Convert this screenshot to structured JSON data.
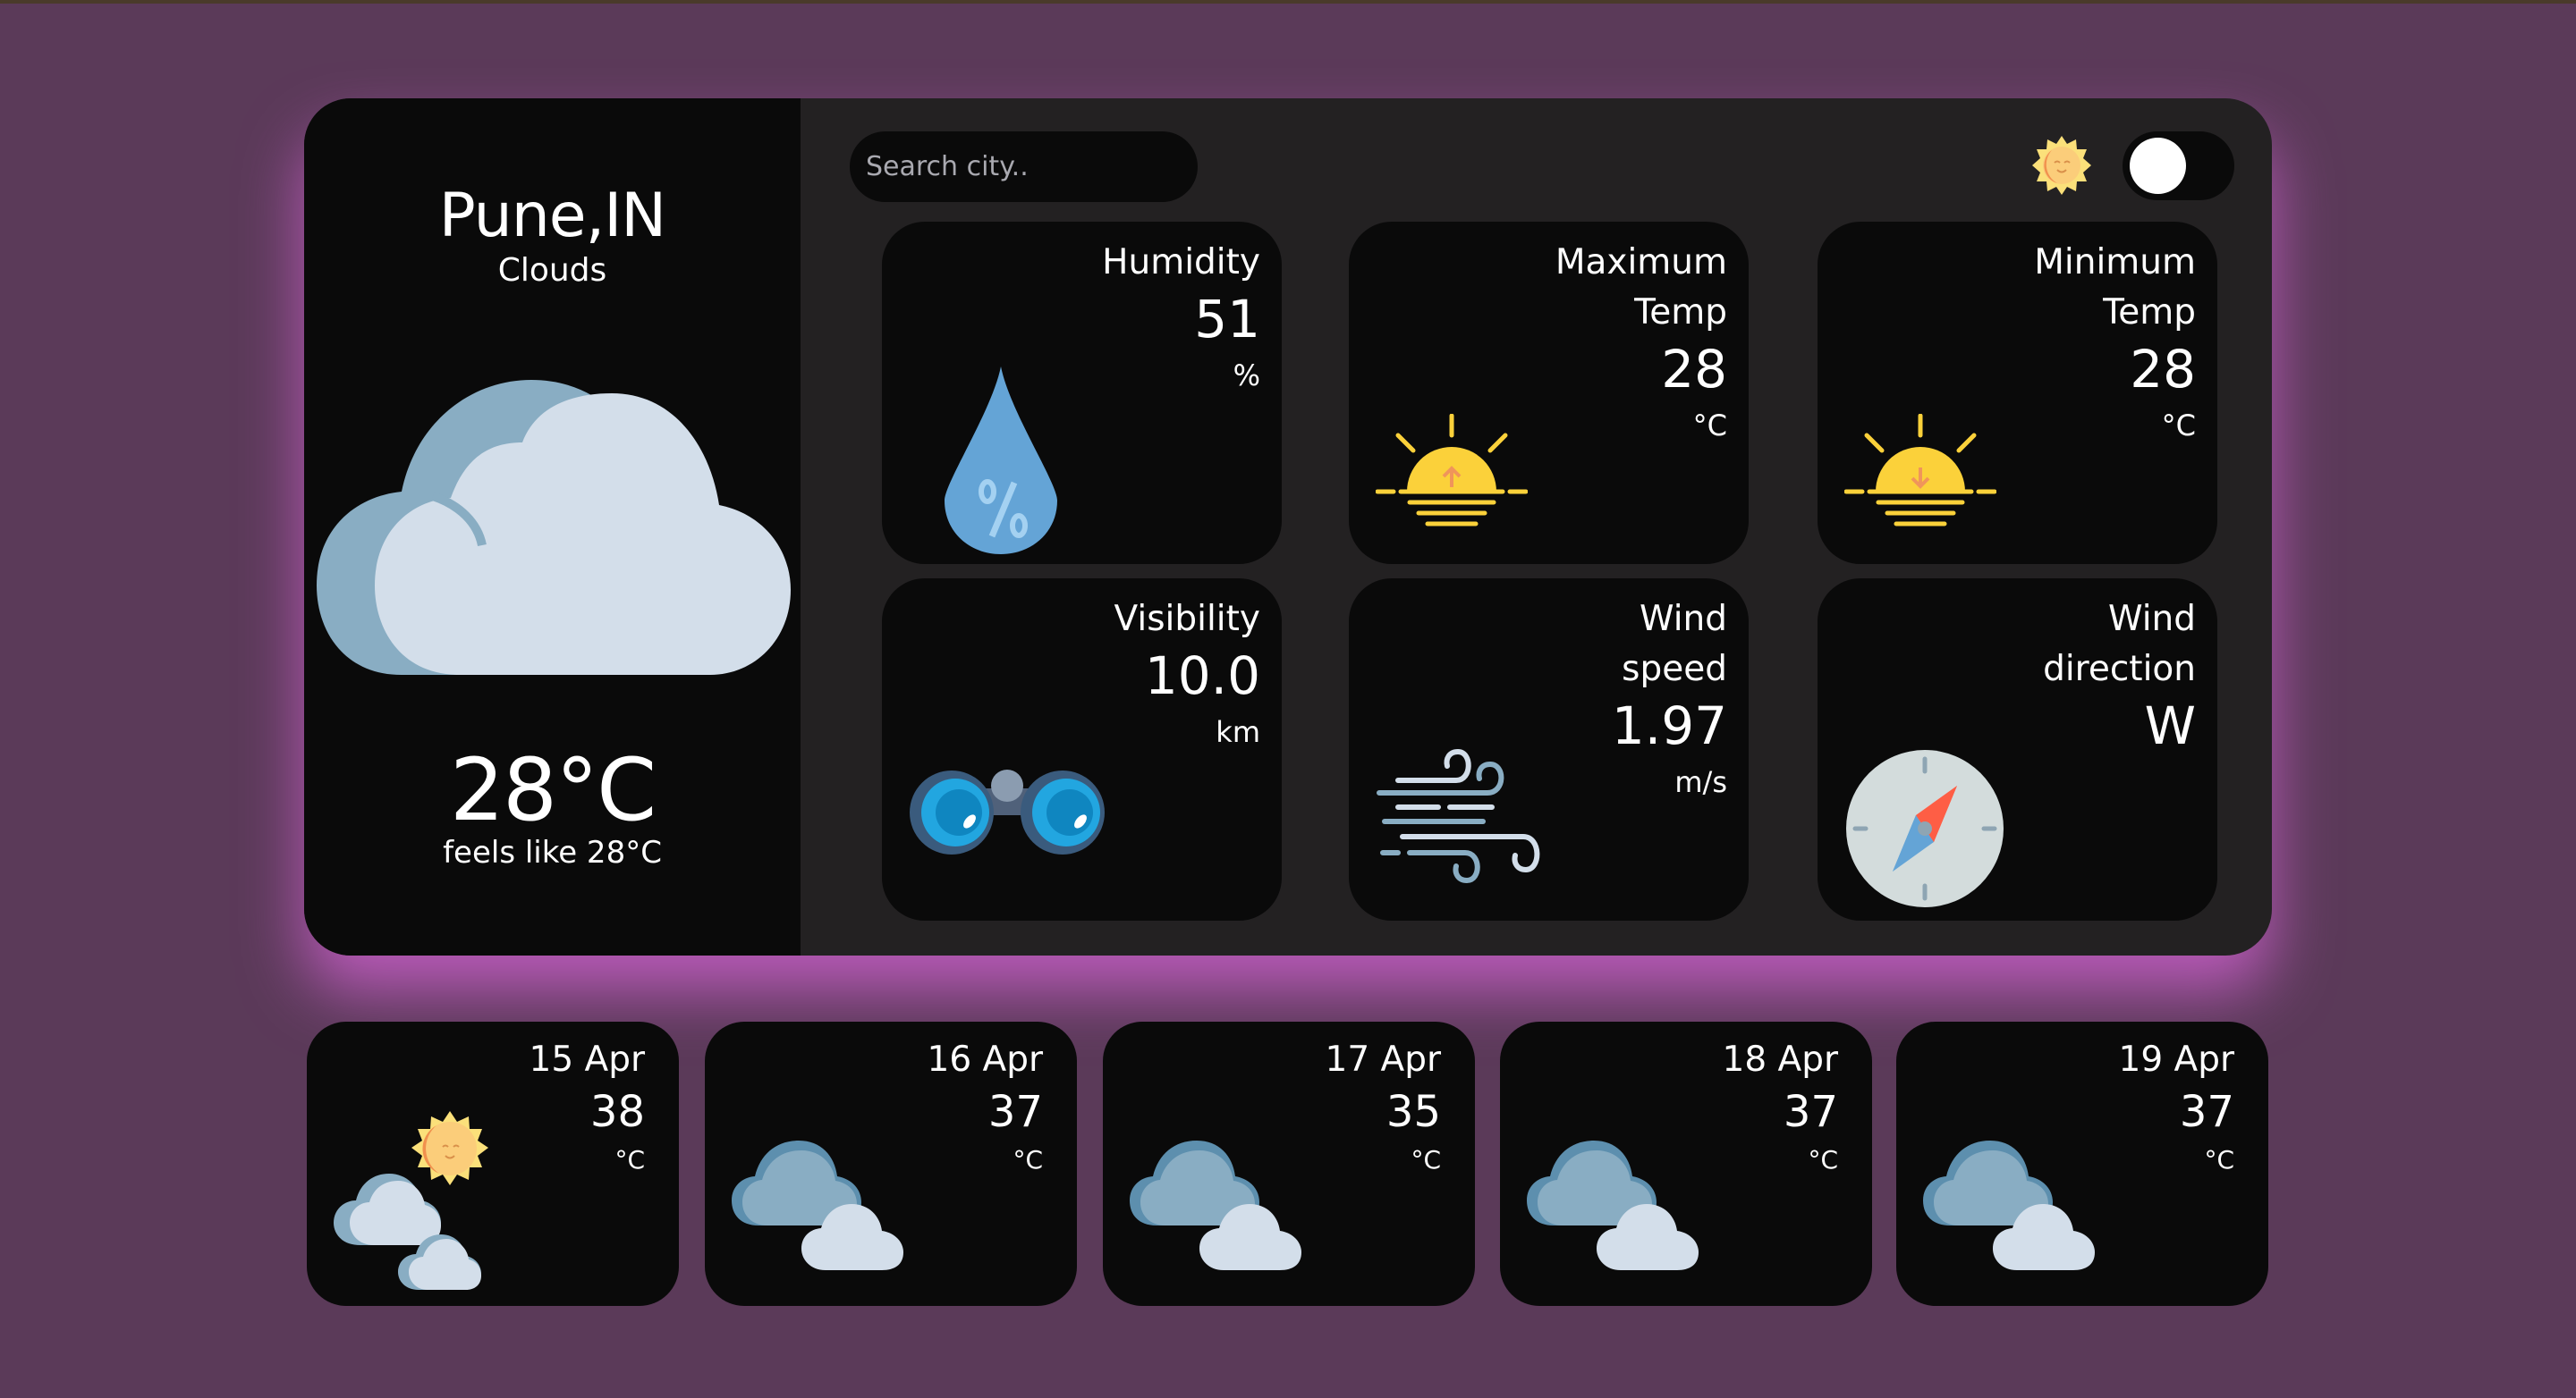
{
  "current": {
    "city": "Pune,IN",
    "condition": "Clouds",
    "temperature": "28°C",
    "feels_like": "feels like 28°C",
    "icon": "cloud-icon"
  },
  "search": {
    "placeholder": "Search city.."
  },
  "theme_toggle": {
    "icon": "sun-icon",
    "state": "off"
  },
  "tiles": [
    {
      "label": [
        "Humidity"
      ],
      "value": "51",
      "unit": "%",
      "icon": "water-drop-percent-icon"
    },
    {
      "label": [
        "Maximum",
        "Temp"
      ],
      "value": "28",
      "unit": "°C",
      "icon": "sunrise-icon"
    },
    {
      "label": [
        "Minimum",
        "Temp"
      ],
      "value": "28",
      "unit": "°C",
      "icon": "sunset-icon"
    },
    {
      "label": [
        "Visibility"
      ],
      "value": "10.0",
      "unit": "km",
      "icon": "binoculars-icon"
    },
    {
      "label": [
        "Wind",
        "speed"
      ],
      "value": "1.97",
      "unit": "m/s",
      "icon": "wind-icon"
    },
    {
      "label": [
        "Wind",
        "direction"
      ],
      "value": "W",
      "icon": "compass-icon"
    }
  ],
  "forecast": [
    {
      "date": "15 Apr",
      "temp": "38",
      "unit": "°C",
      "icon": "sun-clouds-icon"
    },
    {
      "date": "16 Apr",
      "temp": "37",
      "unit": "°C",
      "icon": "clouds-icon"
    },
    {
      "date": "17 Apr",
      "temp": "35",
      "unit": "°C",
      "icon": "clouds-icon"
    },
    {
      "date": "18 Apr",
      "temp": "37",
      "unit": "°C",
      "icon": "clouds-icon"
    },
    {
      "date": "19 Apr",
      "temp": "37",
      "unit": "°C",
      "icon": "clouds-icon"
    }
  ],
  "colors": {
    "background": "#5b3a59",
    "panel": "#232122",
    "card": "#0a0a0a",
    "glow": "#d764d7"
  }
}
